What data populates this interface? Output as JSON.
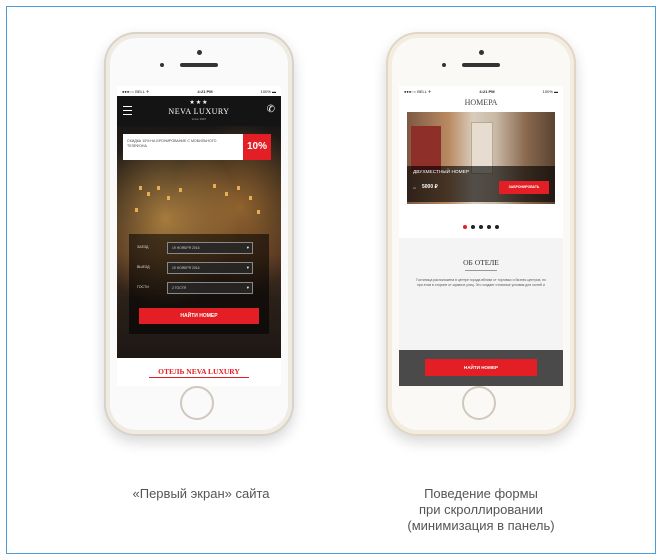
{
  "phone1": {
    "status": {
      "left": "●●●○○ BELL ✈",
      "time": "4:21 PM",
      "right": "100% ▬"
    },
    "header": {
      "stars": "★★★",
      "logo": "NEVA LUXURY",
      "logo_sub": "since 1997",
      "menu_icon": "hamburger-icon",
      "phone_icon": "phone-icon"
    },
    "promo": {
      "text": "СКИДКА 10% НА БРОНИРОВАНИЕ С МОБИЛЬНОГО ТЕЛЕФОНА",
      "percent": "10%"
    },
    "form": {
      "rows": [
        {
          "label": "ЗАЕЗД",
          "value": "19 НОЯБРЯ 2016"
        },
        {
          "label": "ВЫЕЗД",
          "value": "19 НОЯБРЯ 2016"
        },
        {
          "label": "ГОСТИ",
          "value": "2 ГОСТЯ"
        }
      ],
      "button": "НАЙТИ НОМЕР"
    },
    "bottom_title": "ОТЕЛЬ NEVA LUXURY",
    "caption": "«Первый экран» сайта"
  },
  "phone2": {
    "status": {
      "left": "●●●○○ BELL ✈",
      "time": "4:21 PM",
      "right": "100% ▬"
    },
    "title": "НОМЕРА",
    "slide": {
      "room": "ДВУХМЕСТНЫЙ НОМЕР",
      "price_prefix": "от",
      "price": "5000 ₽",
      "button": "ЗАБРОНИРОВАТЬ"
    },
    "about": {
      "title": "ОБ ОТЕЛЕ",
      "text": "Гостиница расположена в центре города вблизи от торговых и бизнес-центров, но при этом в стороне от шумных улиц. Это создает отличные условия для гостей и"
    },
    "panel_button": "НАЙТИ НОМЕР",
    "caption_lines": [
      "Поведение формы",
      "при скроллировании",
      "(минимизация в панель)"
    ]
  },
  "colors": {
    "accent": "#e31e24",
    "frame": "#4b9fd5"
  }
}
